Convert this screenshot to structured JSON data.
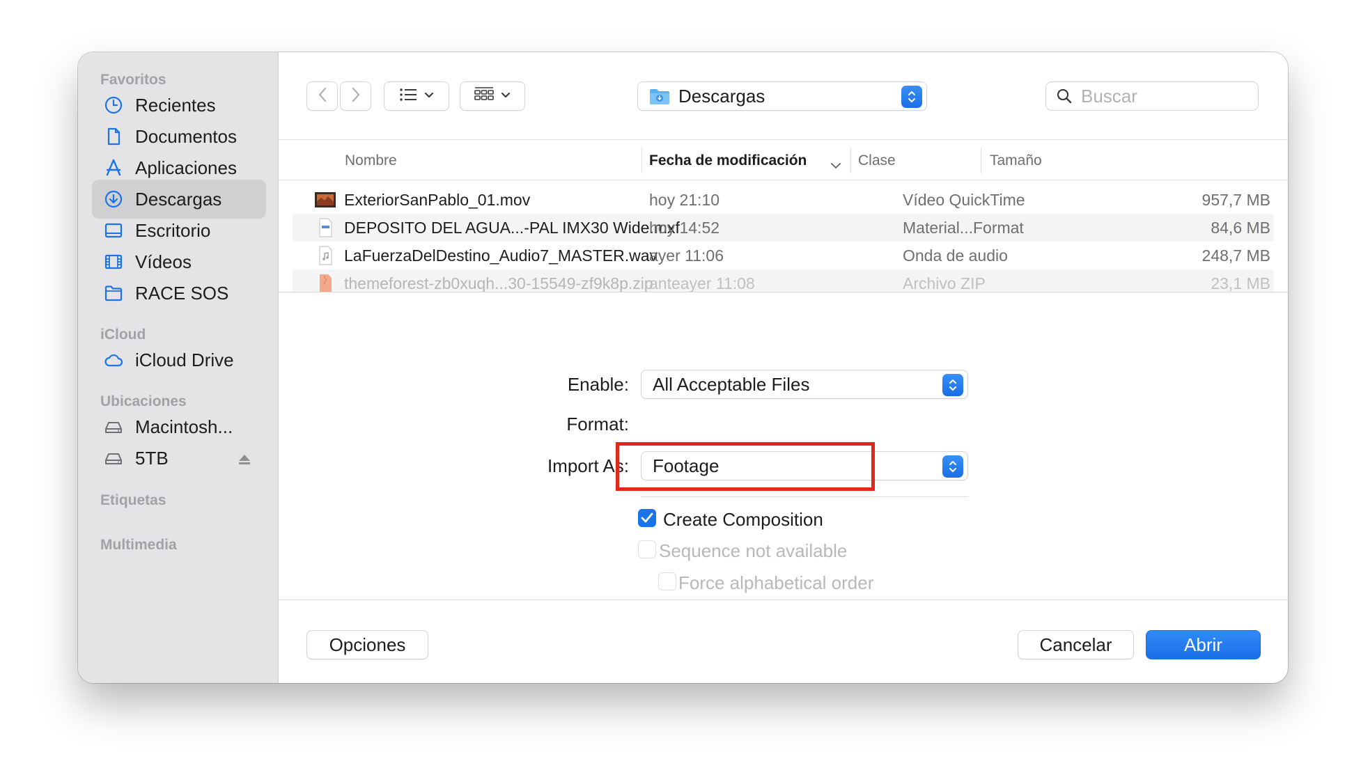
{
  "sidebar": {
    "sections": {
      "favorites": "Favoritos",
      "icloud": "iCloud",
      "locations": "Ubicaciones",
      "tags": "Etiquetas",
      "media": "Multimedia"
    },
    "favorites": [
      {
        "label": "Recientes",
        "icon": "clock-icon"
      },
      {
        "label": "Documentos",
        "icon": "document-icon"
      },
      {
        "label": "Aplicaciones",
        "icon": "applications-icon"
      },
      {
        "label": "Descargas",
        "icon": "downloads-icon",
        "selected": true
      },
      {
        "label": "Escritorio",
        "icon": "desktop-icon"
      },
      {
        "label": "Vídeos",
        "icon": "film-icon"
      },
      {
        "label": "RACE SOS",
        "icon": "folder-icon"
      }
    ],
    "icloud": [
      {
        "label": "iCloud Drive",
        "icon": "cloud-icon"
      }
    ],
    "locations": [
      {
        "label": "Macintosh...",
        "icon": "disk-icon"
      },
      {
        "label": "5TB",
        "icon": "disk-icon"
      }
    ]
  },
  "toolbar": {
    "location": "Descargas",
    "search_placeholder": "Buscar"
  },
  "list": {
    "columns": {
      "name": "Nombre",
      "date": "Fecha de modificación",
      "kind": "Clase",
      "size": "Tamaño"
    },
    "rows": [
      {
        "name": "ExteriorSanPablo_01.mov",
        "date": "hoy 21:10",
        "kind": "Vídeo QuickTime",
        "size": "957,7 MB"
      },
      {
        "name": "DEPOSITO DEL AGUA...-PAL IMX30 Wide.mxf",
        "date": "hoy 14:52",
        "kind": "Material...Format",
        "size": "84,6 MB"
      },
      {
        "name": "LaFuerzaDelDestino_Audio7_MASTER.wav",
        "date": "ayer 11:06",
        "kind": "Onda de audio",
        "size": "248,7 MB"
      },
      {
        "name": "themeforest-zb0xuqh...30-15549-zf9k8p.zip",
        "date": "anteayer 11:08",
        "kind": "Archivo ZIP",
        "size": "23,1 MB"
      }
    ]
  },
  "accessory": {
    "enable_label": "Enable:",
    "enable_value": "All Acceptable Files",
    "format_label": "Format:",
    "import_as_label": "Import As:",
    "import_as_value": "Footage",
    "create_composition": "Create Composition",
    "sequence": "Sequence not available",
    "force_alpha": "Force alphabetical order"
  },
  "footer": {
    "options": "Opciones",
    "cancel": "Cancelar",
    "open": "Abrir"
  },
  "colors": {
    "accent": "#1a73e8",
    "highlight": "#e0281a"
  }
}
